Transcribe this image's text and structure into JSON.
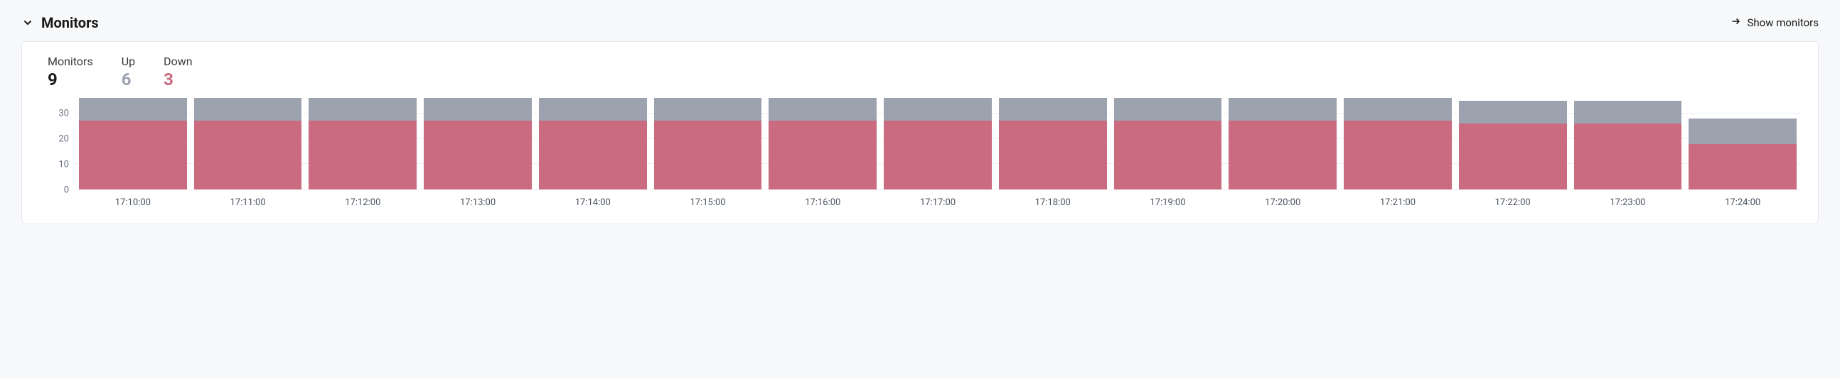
{
  "header": {
    "title": "Monitors",
    "show_link": "Show monitors"
  },
  "stats": {
    "total_label": "Monitors",
    "total_value": "9",
    "up_label": "Up",
    "up_value": "6",
    "down_label": "Down",
    "down_value": "3"
  },
  "colors": {
    "up": "#9ca3af",
    "down": "#ca6b80"
  },
  "chart_data": {
    "type": "bar",
    "categories": [
      "17:10:00",
      "17:11:00",
      "17:12:00",
      "17:13:00",
      "17:14:00",
      "17:15:00",
      "17:16:00",
      "17:17:00",
      "17:18:00",
      "17:19:00",
      "17:20:00",
      "17:21:00",
      "17:22:00",
      "17:23:00",
      "17:24:00"
    ],
    "series": [
      {
        "name": "Down",
        "values": [
          27,
          27,
          27,
          27,
          27,
          27,
          27,
          27,
          27,
          27,
          27,
          27,
          26,
          26,
          18
        ]
      },
      {
        "name": "Up",
        "values": [
          9,
          9,
          9,
          9,
          9,
          9,
          9,
          9,
          9,
          9,
          9,
          9,
          9,
          9,
          10
        ]
      }
    ],
    "ylabel": "",
    "xlabel": "",
    "ylim": [
      0,
      36
    ],
    "yticks": [
      0,
      10,
      20,
      30
    ]
  }
}
